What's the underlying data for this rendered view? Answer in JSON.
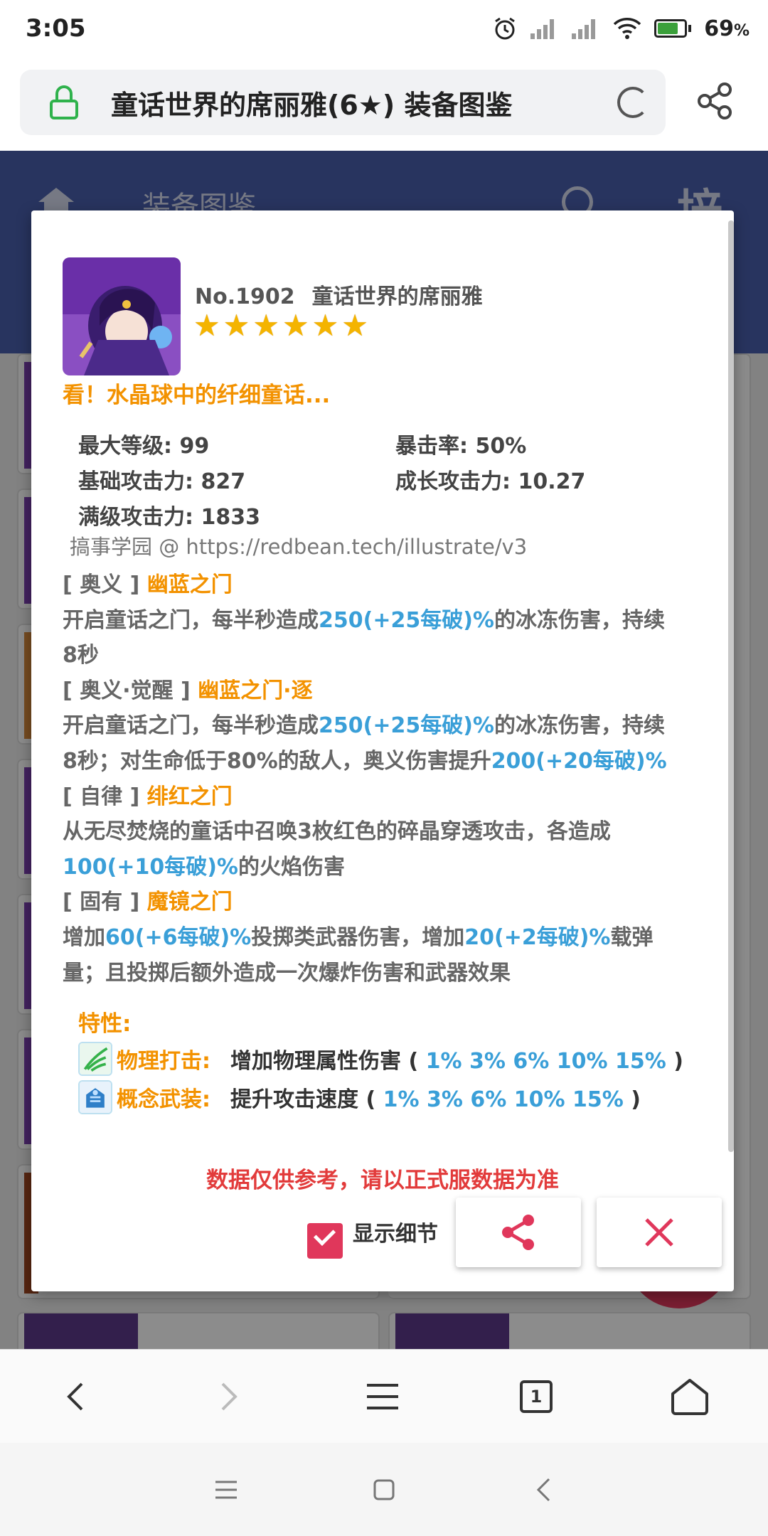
{
  "status_bar": {
    "time": "3:05",
    "battery": "69",
    "battery_unit": "%"
  },
  "browser": {
    "title": "童话世界的席丽雅(6★) 装备图鉴",
    "tab_count": "1"
  },
  "app": {
    "title": "装备图鉴",
    "filter_label": "培"
  },
  "dialog": {
    "number": "No.1902",
    "name": "童话世界的席丽雅",
    "star_count": 6,
    "tagline": "看！水晶球中的纤细童话...",
    "stats": {
      "max_level": "最大等级: 99",
      "crit_rate": "暴击率: 50%",
      "base_atk": "基础攻击力: 827",
      "growth_atk": "成长攻击力: 10.27",
      "max_atk": "满级攻击力: 1833"
    },
    "credit": "搞事学园 @ https://redbean.tech/illustrate/v3",
    "skills": [
      {
        "tag": "[ 奥义 ]",
        "name": "幽蓝之门",
        "lines": [
          [
            {
              "t": "开启童话之门，每半秒造成",
              "c": "gray"
            },
            {
              "t": "250(+25每破)%",
              "c": "blue"
            },
            {
              "t": "的冰冻伤害，持续",
              "c": "gray"
            }
          ],
          [
            {
              "t": "8秒",
              "c": "gray"
            }
          ]
        ]
      },
      {
        "tag": "[ 奥义·觉醒 ]",
        "name": "幽蓝之门·逐",
        "lines": [
          [
            {
              "t": "开启童话之门，每半秒造成",
              "c": "gray"
            },
            {
              "t": "250(+25每破)%",
              "c": "blue"
            },
            {
              "t": "的冰冻伤害，持续",
              "c": "gray"
            }
          ],
          [
            {
              "t": "8秒；对生命低于80%的敌人，奥义伤害提升",
              "c": "gray"
            },
            {
              "t": "200(+20每破)%",
              "c": "blue"
            }
          ]
        ]
      },
      {
        "tag": "[ 自律 ]",
        "name": "绯红之门",
        "lines": [
          [
            {
              "t": "从无尽焚烧的童话中召唤3枚红色的碎晶穿透攻击，各造成",
              "c": "gray"
            }
          ],
          [
            {
              "t": "100(+10每破)%",
              "c": "blue"
            },
            {
              "t": "的火焰伤害",
              "c": "gray"
            }
          ]
        ]
      },
      {
        "tag": "[ 固有 ]",
        "name": "魔镜之门",
        "lines": [
          [
            {
              "t": "增加",
              "c": "gray"
            },
            {
              "t": "60(+6每破)%",
              "c": "blue"
            },
            {
              "t": "投掷类武器伤害，增加",
              "c": "gray"
            },
            {
              "t": "20(+2每破)%",
              "c": "blue"
            },
            {
              "t": "载弹",
              "c": "gray"
            }
          ],
          [
            {
              "t": "量；且投掷后额外造成一次爆炸伤害和武器效果",
              "c": "gray"
            }
          ]
        ]
      }
    ],
    "traits_title": "特性:",
    "traits": [
      {
        "icon": "physical-strike-icon",
        "name": "物理打击:",
        "desc_prefix": "增加物理属性伤害 ( ",
        "values": "1% 3% 6% 10% 15%",
        "desc_suffix": " )"
      },
      {
        "icon": "concept-armament-icon",
        "name": "概念武装:",
        "desc_prefix": "提升攻击速度 ( ",
        "values": "1% 3% 6% 10% 15%",
        "desc_suffix": " )"
      }
    ],
    "disclaimer": "数据仅供参考，请以正式服数据为准",
    "show_details_label": "显示细节",
    "show_details_checked": true
  },
  "colors": {
    "accent_orange": "#f39200",
    "value_blue": "#3a9fd8",
    "brand_pink": "#e0375b",
    "appbar": "#4a5fae"
  }
}
